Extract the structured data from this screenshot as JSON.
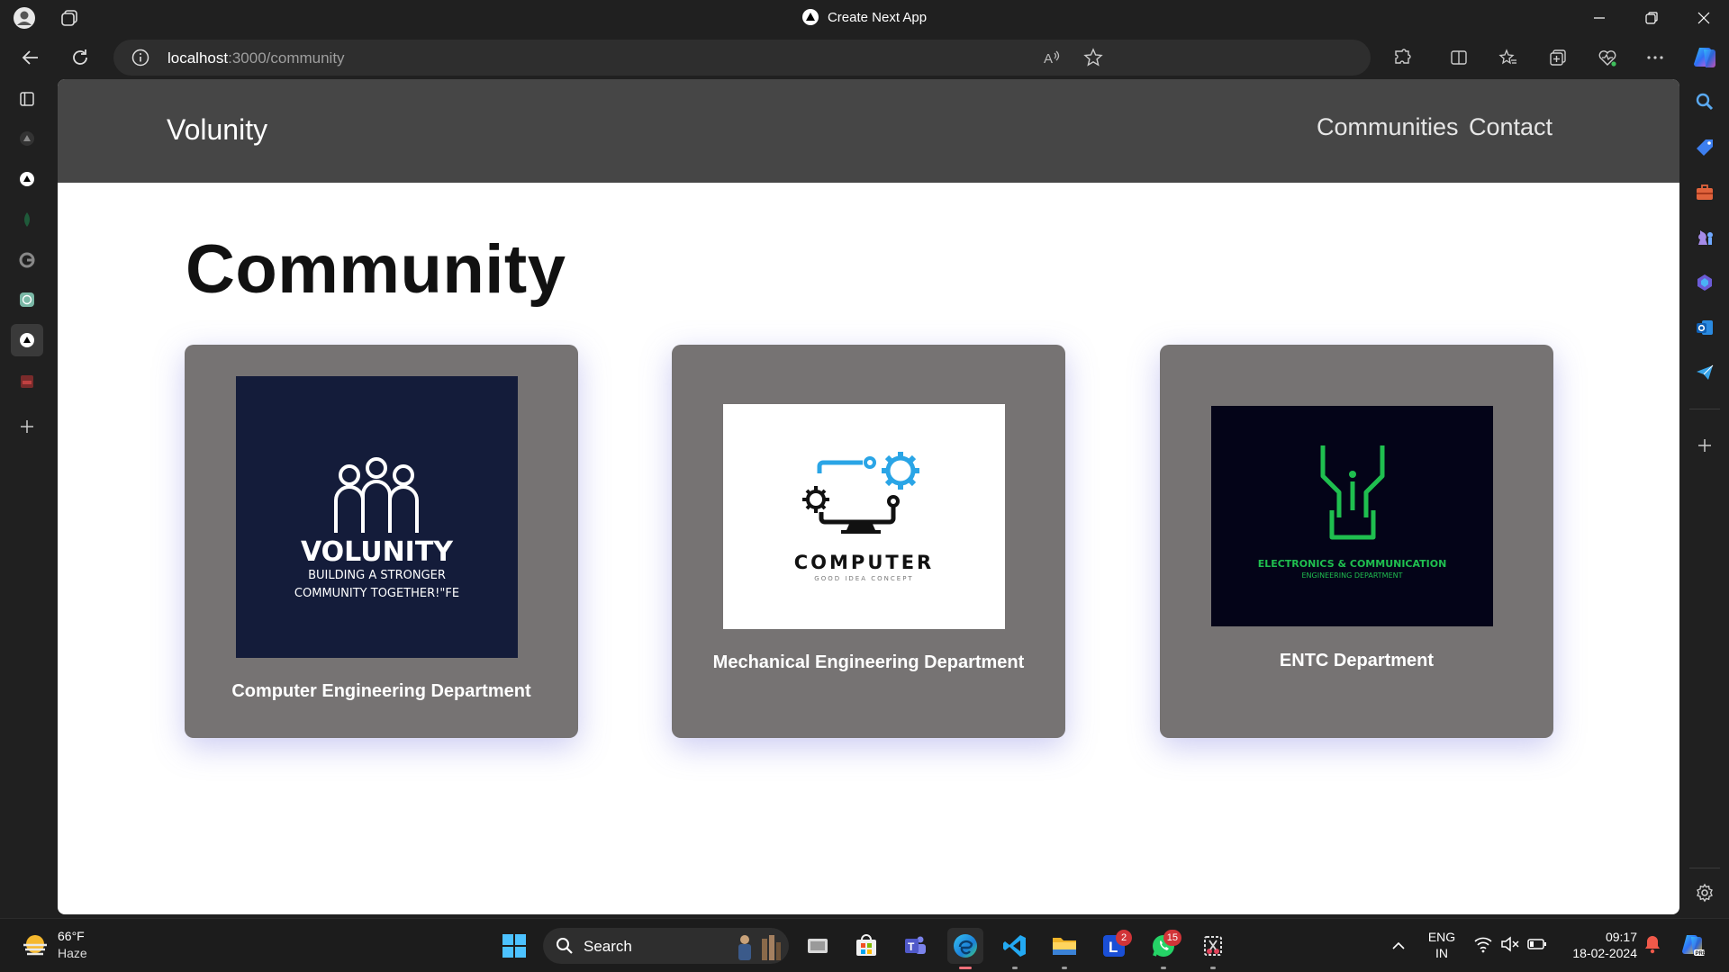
{
  "browser": {
    "window_title": "Create Next App",
    "url_host": "localhost",
    "url_path": ":3000/community"
  },
  "site": {
    "brand": "Volunity",
    "nav": [
      "Communities",
      "Contact"
    ],
    "page_title": "Community"
  },
  "cards": [
    {
      "label": "Computer Engineering Department",
      "logo": {
        "title": "VOLUNITY",
        "line1": "BUILDING A STRONGER",
        "line2": "COMMUNITY TOGETHER!\"FE"
      }
    },
    {
      "label": "Mechanical Engineering Department",
      "logo": {
        "title": "COMPUTER",
        "subtitle": "GOOD IDEA CONCEPT"
      }
    },
    {
      "label": "ENTC Department",
      "logo": {
        "line1": "ELECTRONICS & COMMUNICATION",
        "line2": "ENGINEERING DEPARTMENT"
      }
    }
  ],
  "taskbar": {
    "weather_temp": "66°F",
    "weather_desc": "Haze",
    "search_label": "Search",
    "lang_top": "ENG",
    "lang_bottom": "IN",
    "time": "09:17",
    "date": "18-02-2024",
    "badge_l": "2",
    "badge_whatsapp": "15"
  },
  "colors": {
    "nav_bg": "#464646",
    "card_bg": "#767373",
    "volunity_bg": "#141c3a",
    "entc_bg": "#040418",
    "entc_green": "#1fbf4f",
    "computer_blue": "#2aa5e6"
  }
}
